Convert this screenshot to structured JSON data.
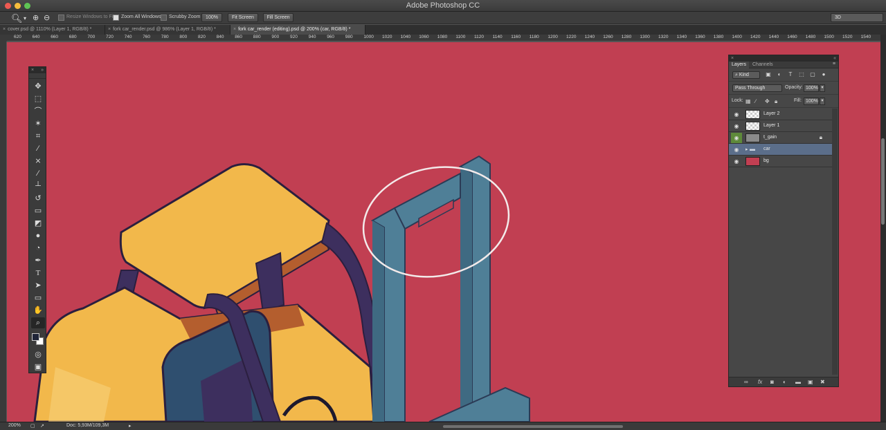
{
  "window": {
    "title": "Adobe Photoshop CC"
  },
  "options": {
    "resize_windows": "Resize Windows to Fit",
    "zoom_all": "Zoom All Windows",
    "scrubby": "Scrubby Zoom",
    "btn_100": "100%",
    "btn_fit": "Fit Screen",
    "btn_fill": "Fill Screen",
    "workspace": "3D"
  },
  "tabs": [
    {
      "label": "cover.psd @ 1110% (Layer 1, RGB/8) *"
    },
    {
      "label": "fork car_render.psd @ 986% (Layer 1, RGB/8) *"
    },
    {
      "label": "fork car_render (editing).psd @ 200% (car, RGB/8) *"
    }
  ],
  "ruler": [
    "620",
    "640",
    "660",
    "680",
    "700",
    "720",
    "740",
    "760",
    "780",
    "800",
    "820",
    "840",
    "860",
    "880",
    "900",
    "920",
    "940",
    "960",
    "980",
    "1000",
    "1020",
    "1040",
    "1060",
    "1080",
    "1100",
    "1120",
    "1140",
    "1160",
    "1180",
    "1200",
    "1220",
    "1240",
    "1260",
    "1280",
    "1300",
    "1320",
    "1340",
    "1360",
    "1380",
    "1400",
    "1420",
    "1440",
    "1460",
    "1480",
    "1500",
    "1520",
    "1540"
  ],
  "layers_panel": {
    "tab_layers": "Layers",
    "tab_channels": "Channels",
    "kind": "Kind",
    "blend_mode": "Pass Through",
    "opacity_label": "Opacity:",
    "opacity": "100%",
    "lock_label": "Lock:",
    "fill_label": "Fill:",
    "fill": "100%",
    "layers": [
      {
        "name": "Layer 2"
      },
      {
        "name": "Layer 1"
      },
      {
        "name": "t_gain"
      },
      {
        "name": "car"
      },
      {
        "name": "bg"
      }
    ]
  },
  "status": {
    "zoom": "200%",
    "doc": "Doc: 5,93M/109,3M"
  },
  "colors": {
    "canvas": "#c13f52",
    "roof": "#f2b84b",
    "frame": "#3d2f5e",
    "mast": "#4f7f97"
  }
}
